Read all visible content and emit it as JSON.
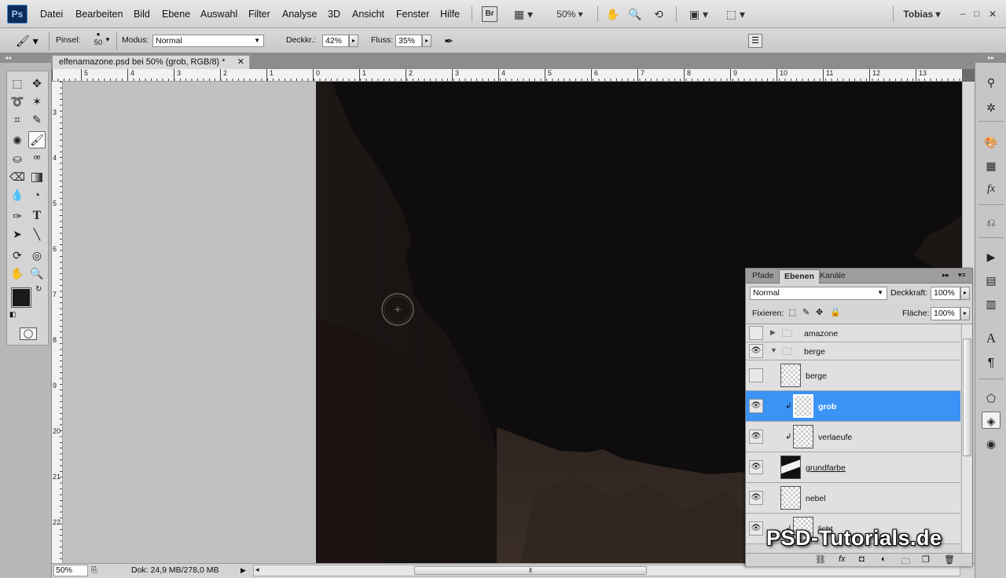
{
  "menu": {
    "app_logo": "Ps",
    "items": [
      "Datei",
      "Bearbeiten",
      "Bild",
      "Ebene",
      "Auswahl",
      "Filter",
      "Analyse",
      "3D",
      "Ansicht",
      "Fenster",
      "Hilfe"
    ],
    "bridge_label": "Br",
    "zoom": "50%",
    "user": "Tobias"
  },
  "options": {
    "brush_label": "Pinsel:",
    "brush_size": "50",
    "mode_label": "Modus:",
    "mode_value": "Normal",
    "opacity_label": "Deckkr.:",
    "opacity_value": "42%",
    "flow_label": "Fluss:",
    "flow_value": "35%"
  },
  "document": {
    "tab_title": "elfenamazone.psd bei 50% (grob, RGB/8) *",
    "ruler_top": [
      "5",
      "4",
      "3",
      "2",
      "1",
      "0",
      "1",
      "2",
      "3",
      "4",
      "5",
      "6",
      "7",
      "8",
      "9",
      "10",
      "11",
      "12",
      "13"
    ],
    "ruler_left": [
      "3",
      "4",
      "5",
      "6",
      "7",
      "8",
      "9",
      "20",
      "21",
      "22"
    ]
  },
  "status": {
    "zoom": "50%",
    "doc_info": "Dok: 24,9 MB/278,0 MB"
  },
  "layers_panel": {
    "tabs": [
      "Pfade",
      "Ebenen",
      "Kanäle"
    ],
    "blend_mode": "Normal",
    "opacity_label": "Deckkraft:",
    "opacity_value": "100%",
    "lock_label": "Fixieren:",
    "fill_label": "Fläche:",
    "fill_value": "100%",
    "layers": [
      {
        "name": "amazone",
        "type": "group",
        "visible": false
      },
      {
        "name": "berge",
        "type": "group",
        "visible": true
      },
      {
        "name": "berge",
        "type": "layer",
        "visible": false
      },
      {
        "name": "grob",
        "type": "layer",
        "visible": true,
        "selected": true
      },
      {
        "name": "verlaeufe",
        "type": "layer",
        "visible": true
      },
      {
        "name": "grundfarbe",
        "type": "layer",
        "visible": true
      },
      {
        "name": "nebel",
        "type": "layer",
        "visible": true
      },
      {
        "name": "licht",
        "type": "layer",
        "visible": true
      }
    ]
  },
  "watermark": "PSD-Tutorials.de"
}
